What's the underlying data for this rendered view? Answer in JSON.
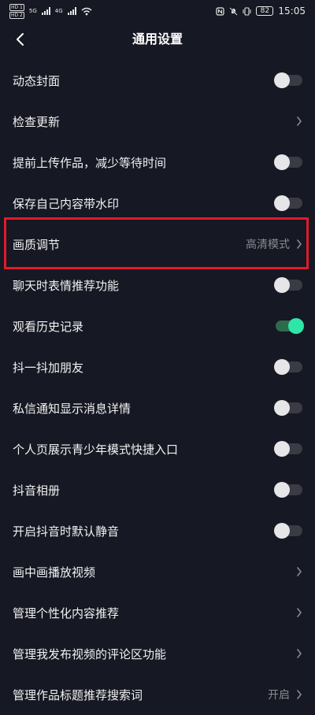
{
  "status_bar": {
    "hd1": "HD 1",
    "hd2": "HD 2",
    "net1": "5G",
    "net2": "4G",
    "battery": "82",
    "time": "15:05"
  },
  "header": {
    "title": "通用设置"
  },
  "colors": {
    "background": "#161823",
    "toggle_on": "#2ee6a8",
    "highlight_border": "#e21a2b",
    "secondary_text": "#8a8b91"
  },
  "items": [
    {
      "label": "动态封面",
      "control": "toggle",
      "on": false
    },
    {
      "label": "检查更新",
      "control": "chevron"
    },
    {
      "label": "提前上传作品，减少等待时间",
      "control": "toggle",
      "on": false
    },
    {
      "label": "保存自己内容带水印",
      "control": "toggle",
      "on": false
    },
    {
      "label": "画质调节",
      "control": "chevron",
      "value": "高清模式",
      "highlighted": true
    },
    {
      "label": "聊天时表情推荐功能",
      "control": "toggle",
      "on": false
    },
    {
      "label": "观看历史记录",
      "control": "toggle",
      "on": true
    },
    {
      "label": "抖一抖加朋友",
      "control": "toggle",
      "on": false
    },
    {
      "label": "私信通知显示消息详情",
      "control": "toggle",
      "on": false
    },
    {
      "label": "个人页展示青少年模式快捷入口",
      "control": "toggle",
      "on": false
    },
    {
      "label": "抖音相册",
      "control": "toggle",
      "on": false
    },
    {
      "label": "开启抖音时默认静音",
      "control": "toggle",
      "on": false
    },
    {
      "label": "画中画播放视频",
      "control": "chevron"
    },
    {
      "label": "管理个性化内容推荐",
      "control": "chevron"
    },
    {
      "label": "管理我发布视频的评论区功能",
      "control": "chevron"
    },
    {
      "label": "管理作品标题推荐搜索词",
      "control": "chevron",
      "value": "开启"
    }
  ]
}
